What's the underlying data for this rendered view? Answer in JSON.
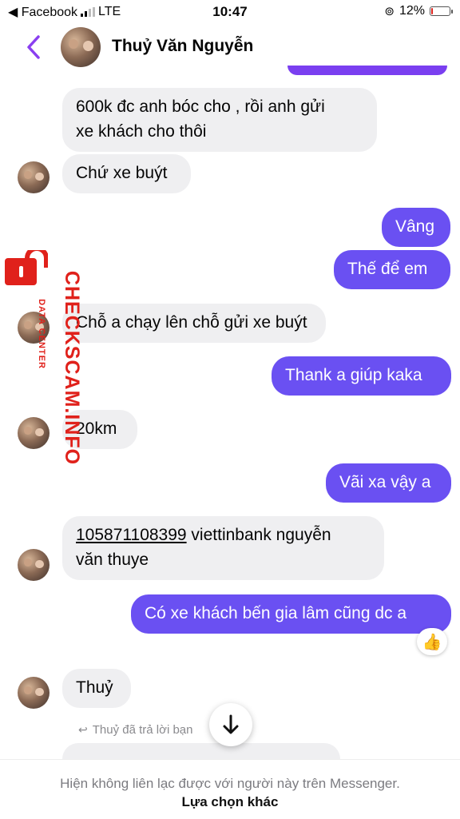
{
  "status_bar": {
    "carrier": "◀ Facebook",
    "network": "LTE",
    "time": "10:47",
    "battery": "12%",
    "battery_level": 0.12
  },
  "header": {
    "contact_name": "Thuỷ Văn Nguyễn"
  },
  "messages": [
    {
      "side": "in",
      "text_lines": [
        "600k đc anh bóc cho , rồi anh gửi",
        "xe khách cho thôi"
      ]
    },
    {
      "side": "in",
      "text": "Chứ xe buýt"
    },
    {
      "side": "out",
      "text": "Vâng"
    },
    {
      "side": "out",
      "text": "Thế để em"
    },
    {
      "side": "in",
      "text": "Chỗ a chạy lên chỗ gửi xe buýt"
    },
    {
      "side": "out",
      "text": "Thank a giúp kaka"
    },
    {
      "side": "in",
      "text": "20km"
    },
    {
      "side": "out",
      "text": "Vãi xa vậy a"
    },
    {
      "side": "in",
      "account_number": "105871108399",
      "text_rest": " viettinbank nguyễn",
      "text_line2": "văn thuye"
    },
    {
      "side": "out",
      "text": "Có xe khách bến gia lâm cũng dc a",
      "reaction": "👍"
    },
    {
      "side": "in",
      "text": "Thuỷ"
    }
  ],
  "reply_note": "Thuỷ đã trả lời bạn",
  "watermark": {
    "main": "CHECKSCAM.INFO",
    "sub": "DATA CENTER"
  },
  "footer": {
    "notice": "Hiện không liên lạc được với người này trên Messenger.",
    "other_options": "Lựa chọn khác"
  },
  "colors": {
    "accent": "#6a50f2",
    "incoming_bubble": "#efeff1",
    "watermark": "#e0211b"
  }
}
